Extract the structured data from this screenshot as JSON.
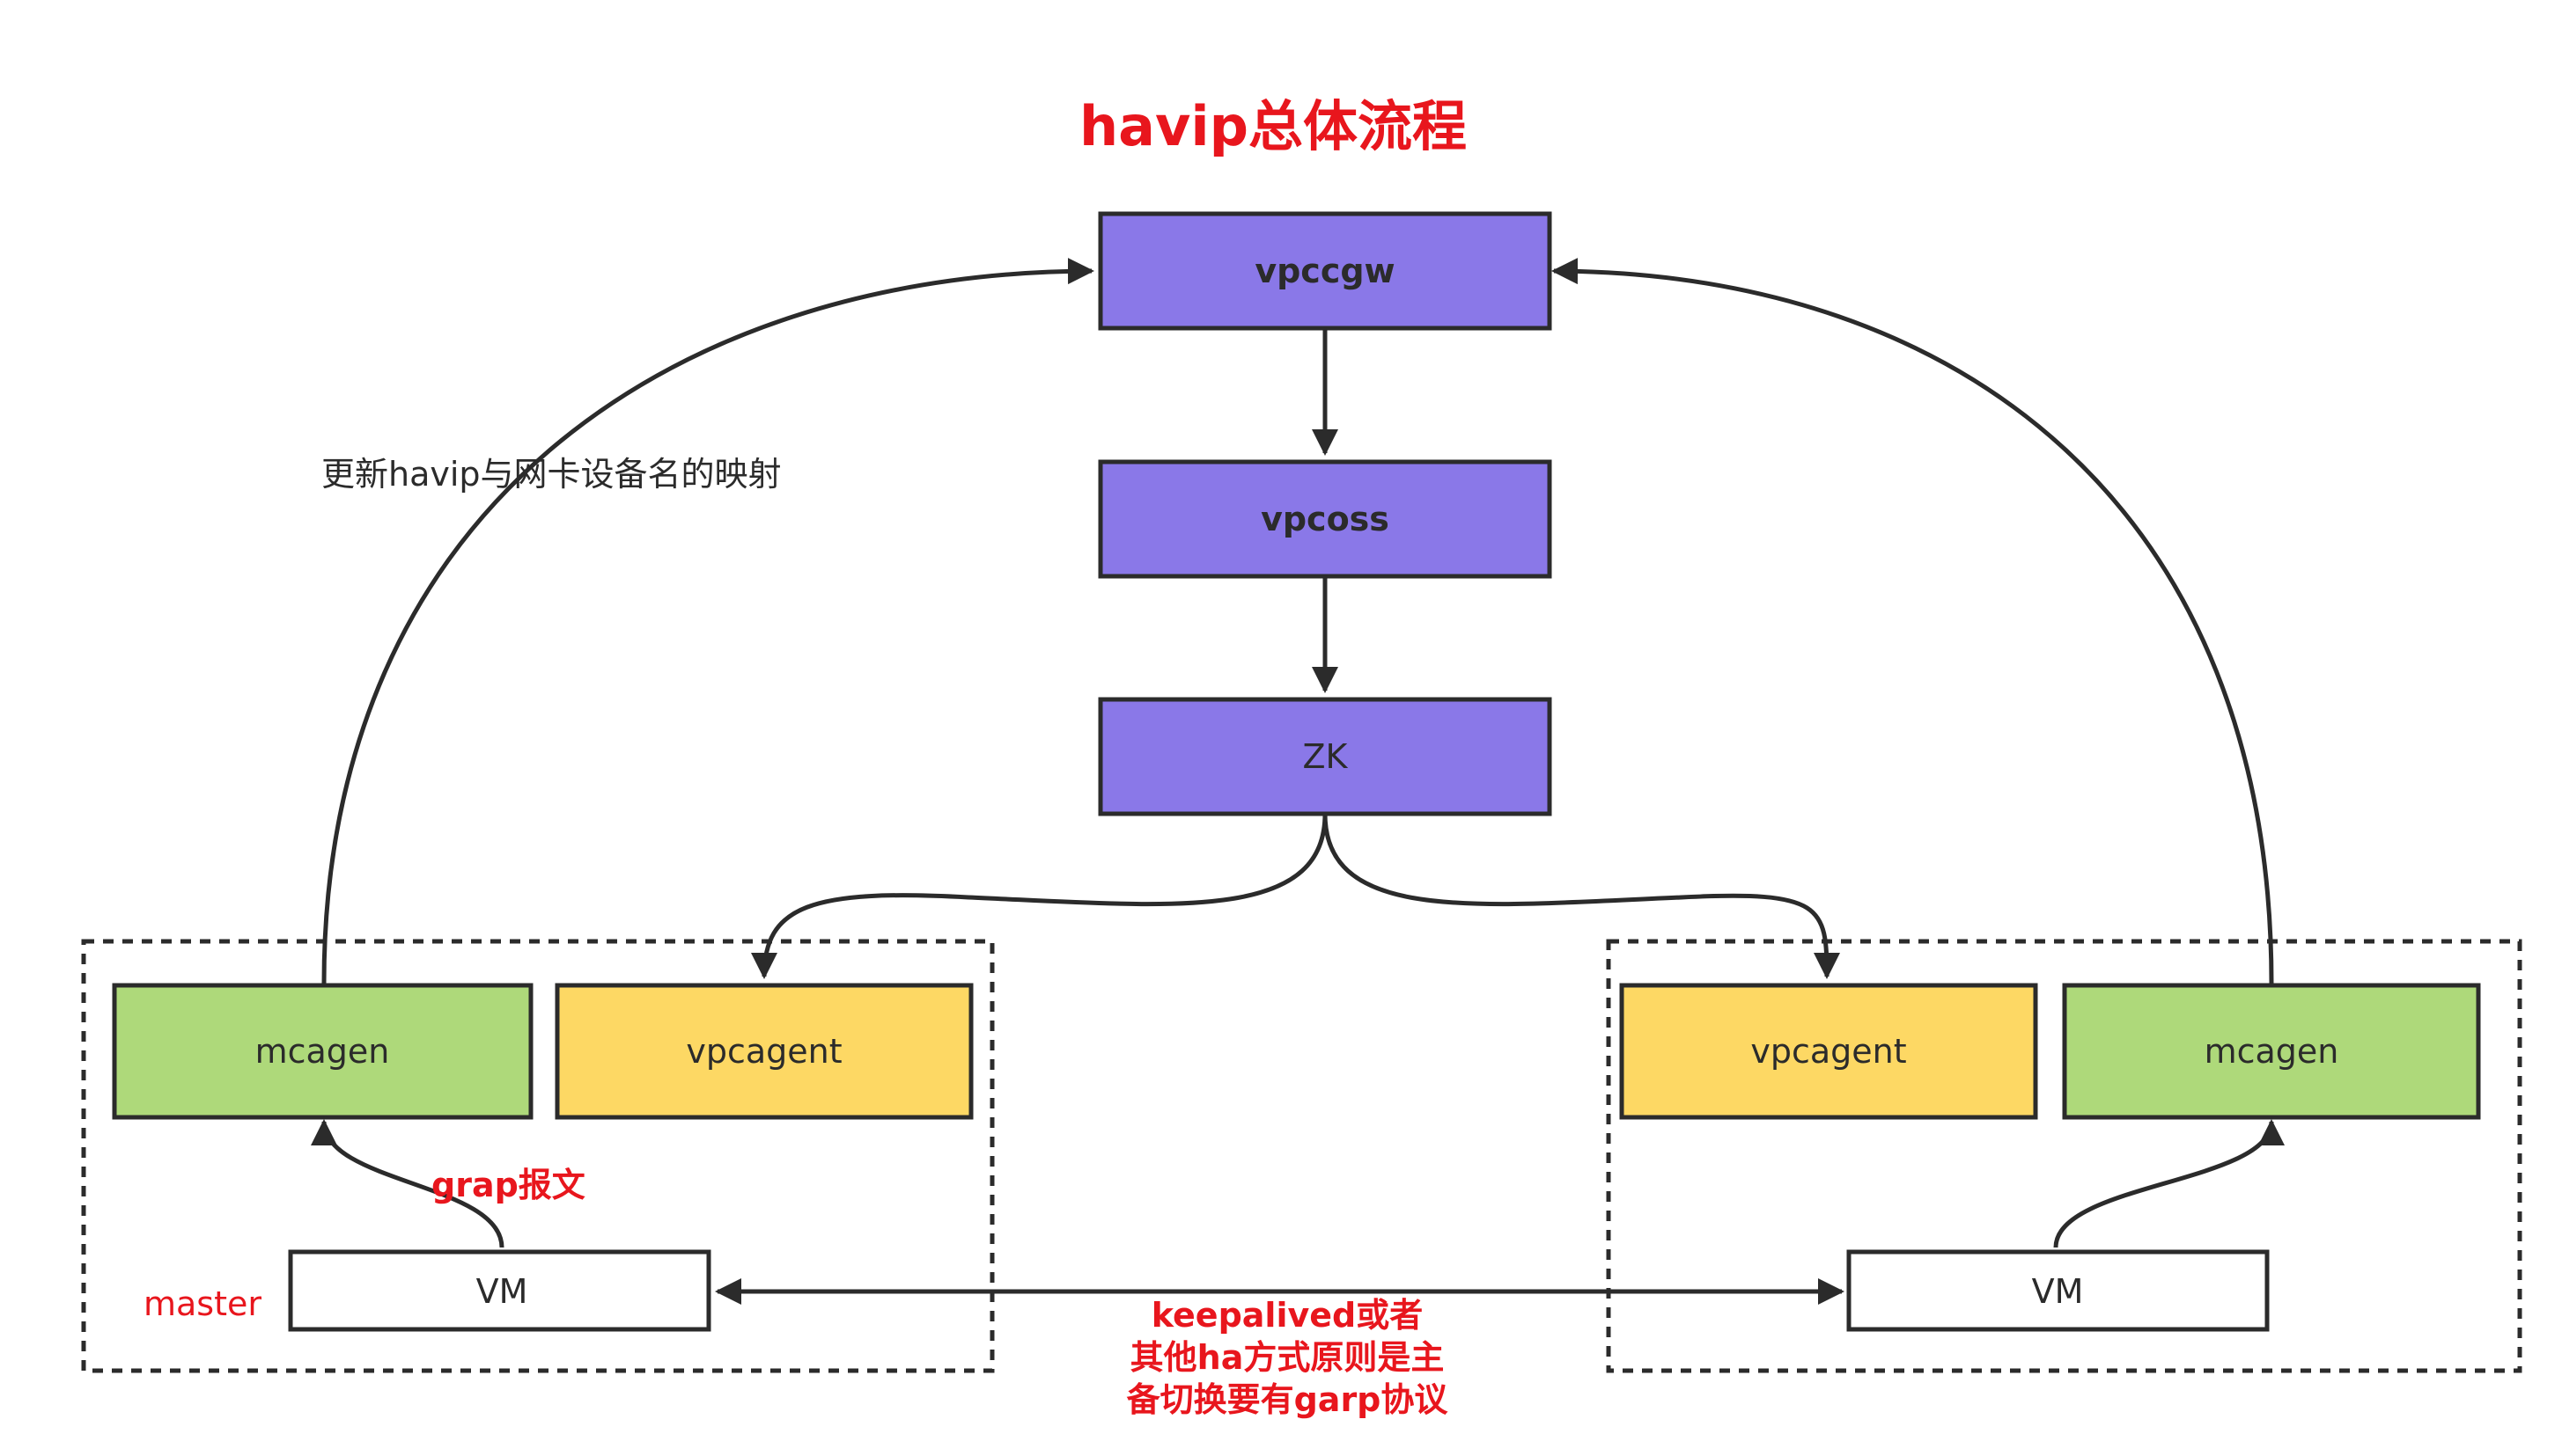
{
  "title": "havip总体流程",
  "colors": {
    "purple": "#8a78e8",
    "green": "#aed97a",
    "yellow": "#fdd864",
    "white": "#ffffff",
    "stroke": "#2b2b2b",
    "red": "#e8161d"
  },
  "nodes": {
    "vpccgw": "vpccgw",
    "vpcoss": "vpcoss",
    "zk": "ZK",
    "mcagen_left": "mcagen",
    "vpcagent_left": "vpcagent",
    "vpcagent_right": "vpcagent",
    "mcagen_right": "mcagen",
    "vm_left": "VM",
    "vm_right": "VM"
  },
  "labels": {
    "mapping_update": "更新havip与网卡设备名的映射",
    "grap_packet": "grap报文",
    "master": "master",
    "keepalived_line1": "keepalived或者",
    "keepalived_line2": "其他ha方式原则是主",
    "keepalived_line3": "备切换要有garp协议"
  }
}
